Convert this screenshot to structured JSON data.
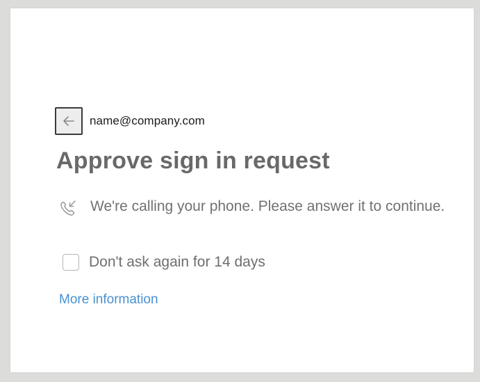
{
  "identity": {
    "email": "name@company.com",
    "back_icon": "arrow-left-icon"
  },
  "title": "Approve sign in request",
  "call": {
    "icon": "incoming-call-icon",
    "message": "We're calling your phone. Please answer it to continue."
  },
  "remember": {
    "label": "Don't ask again for 14 days",
    "checked": false
  },
  "more_info": {
    "label": "More information"
  },
  "colors": {
    "link": "#4a91d0",
    "title": "#696969",
    "body_text": "#717171",
    "background": "#dcdcda",
    "card": "#ffffff"
  }
}
